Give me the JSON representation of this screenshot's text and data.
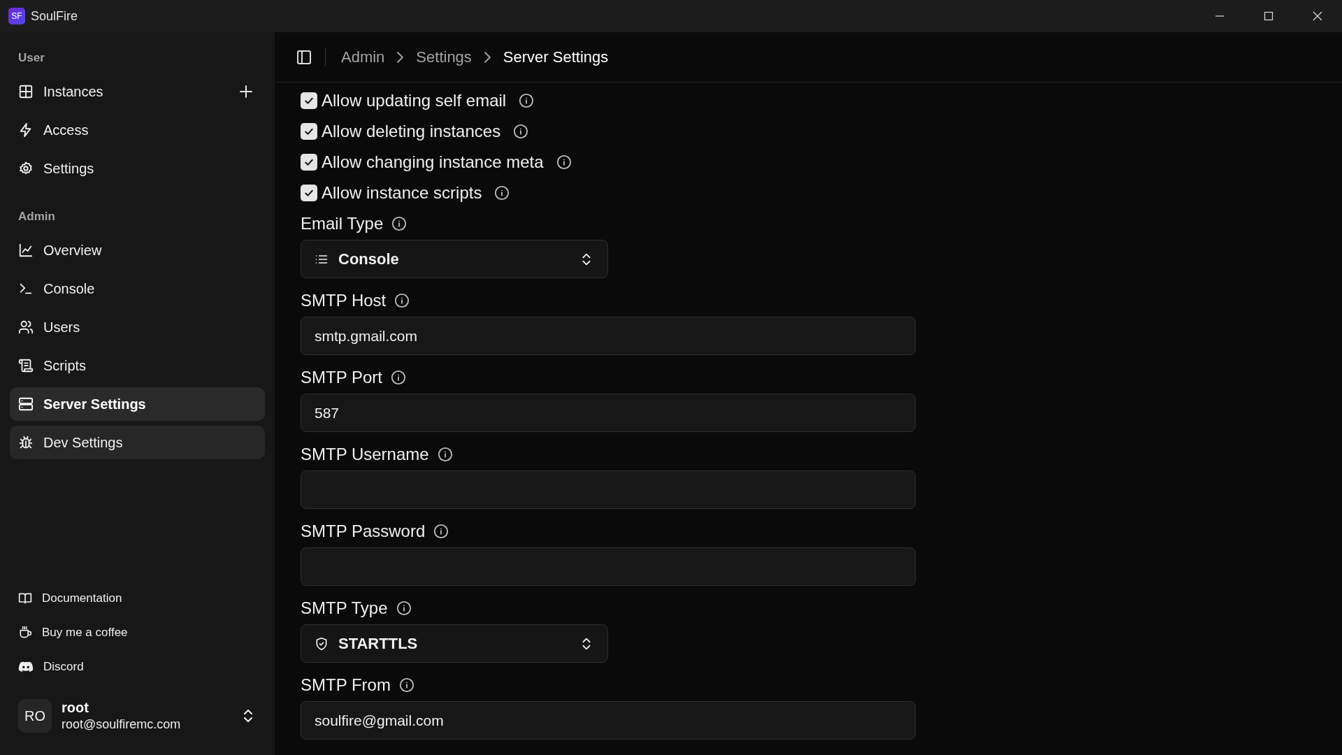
{
  "window": {
    "logo": "SF",
    "title": "SoulFire"
  },
  "sidebar": {
    "sections": [
      {
        "heading": "User",
        "items": [
          {
            "label": "Instances",
            "selected": false,
            "hovered": false,
            "add_button": true
          },
          {
            "label": "Access",
            "selected": false,
            "hovered": false
          },
          {
            "label": "Settings",
            "selected": false,
            "hovered": false
          }
        ]
      },
      {
        "heading": "Admin",
        "items": [
          {
            "label": "Overview",
            "selected": false,
            "hovered": false
          },
          {
            "label": "Console",
            "selected": false,
            "hovered": false
          },
          {
            "label": "Users",
            "selected": false,
            "hovered": false
          },
          {
            "label": "Scripts",
            "selected": false,
            "hovered": false
          },
          {
            "label": "Server Settings",
            "selected": true,
            "hovered": false
          },
          {
            "label": "Dev Settings",
            "selected": false,
            "hovered": true
          }
        ]
      }
    ],
    "footer_links": [
      "Documentation",
      "Buy me a coffee",
      "Discord"
    ],
    "user": {
      "initials": "RO",
      "name": "root",
      "email": "root@soulfiremc.com"
    }
  },
  "breadcrumb": [
    "Admin",
    "Settings",
    "Server Settings"
  ],
  "checkboxes": [
    {
      "label": "Allow updating self email",
      "checked": true
    },
    {
      "label": "Allow deleting instances",
      "checked": true
    },
    {
      "label": "Allow changing instance meta",
      "checked": true
    },
    {
      "label": "Allow instance scripts",
      "checked": true
    }
  ],
  "fields": [
    {
      "kind": "select",
      "label": "Email Type",
      "value": "Console"
    },
    {
      "kind": "text",
      "label": "SMTP Host",
      "value": "smtp.gmail.com"
    },
    {
      "kind": "text",
      "label": "SMTP Port",
      "value": "587"
    },
    {
      "kind": "text",
      "label": "SMTP Username"
    },
    {
      "kind": "password",
      "label": "SMTP Password"
    },
    {
      "kind": "select",
      "label": "SMTP Type",
      "value": "STARTTLS"
    },
    {
      "kind": "text",
      "label": "SMTP From",
      "value": "soulfire@gmail.com"
    }
  ]
}
